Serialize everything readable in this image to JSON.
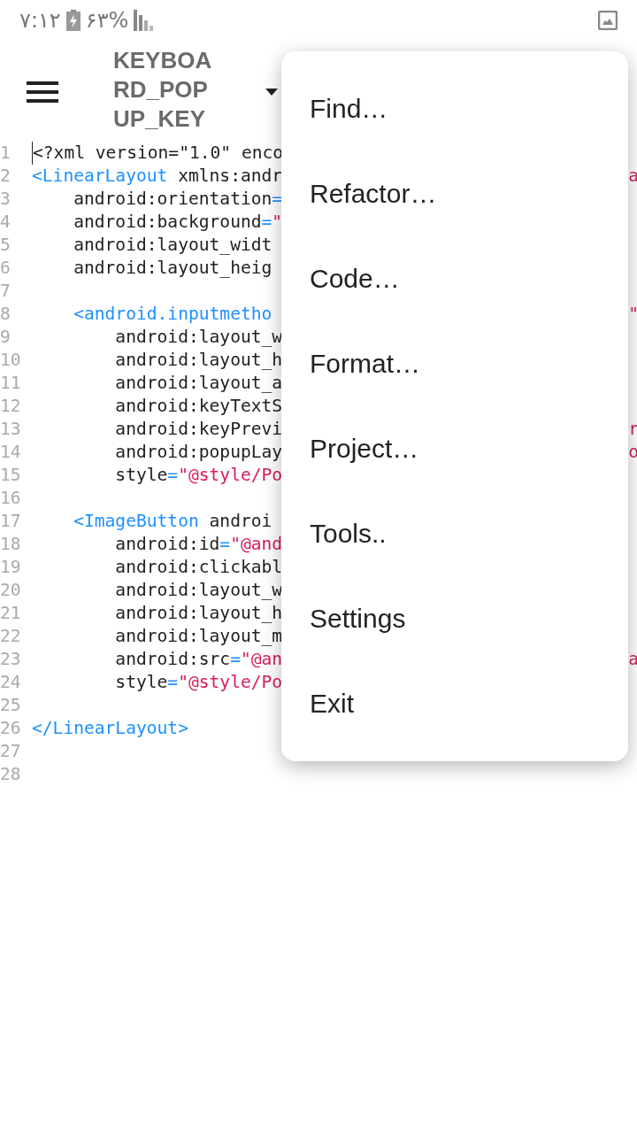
{
  "status_bar": {
    "time": "۷:۱۲",
    "battery": "۶۳%"
  },
  "toolbar": {
    "title": "KEYBOARD_POPUP_KEY"
  },
  "editor": {
    "lines": [
      {
        "number": "1",
        "cursor": true,
        "segments": [
          {
            "kind": "plain",
            "text": "<?xml version=\"1.0\" enco"
          }
        ]
      },
      {
        "number": "2",
        "cursor": false,
        "segments": [
          {
            "kind": "tag",
            "text": "<LinearLayout"
          },
          {
            "kind": "plain",
            "text": " xmlns:andr"
          }
        ],
        "tail": "a"
      },
      {
        "number": "3",
        "cursor": false,
        "segments": [
          {
            "kind": "plain",
            "text": "    android:orientation"
          },
          {
            "kind": "op",
            "text": "="
          }
        ]
      },
      {
        "number": "4",
        "cursor": false,
        "segments": [
          {
            "kind": "plain",
            "text": "    android:background"
          },
          {
            "kind": "op",
            "text": "="
          },
          {
            "kind": "value",
            "text": "\""
          }
        ]
      },
      {
        "number": "5",
        "cursor": false,
        "segments": [
          {
            "kind": "plain",
            "text": "    android:layout_widt"
          }
        ]
      },
      {
        "number": "6",
        "cursor": false,
        "segments": [
          {
            "kind": "plain",
            "text": "    android:layout_heig"
          }
        ]
      },
      {
        "number": "7",
        "cursor": false
      },
      {
        "number": "8",
        "cursor": false,
        "segments": [
          {
            "kind": "tag",
            "text": "    <android.inputmetho"
          }
        ],
        "tail": "\""
      },
      {
        "number": "9",
        "cursor": false,
        "segments": [
          {
            "kind": "plain",
            "text": "        android:layout_w"
          }
        ]
      },
      {
        "number": "10",
        "cursor": false,
        "segments": [
          {
            "kind": "plain",
            "text": "        android:layout_h"
          }
        ]
      },
      {
        "number": "11",
        "cursor": false,
        "segments": [
          {
            "kind": "plain",
            "text": "        android:layout_a"
          }
        ]
      },
      {
        "number": "12",
        "cursor": false,
        "segments": [
          {
            "kind": "plain",
            "text": "        android:keyTextS"
          }
        ]
      },
      {
        "number": "13",
        "cursor": false,
        "segments": [
          {
            "kind": "plain",
            "text": "        android:keyPrevi"
          }
        ],
        "tail": "r"
      },
      {
        "number": "14",
        "cursor": false,
        "segments": [
          {
            "kind": "plain",
            "text": "        android:popupLay"
          }
        ],
        "tail": "o"
      },
      {
        "number": "15",
        "cursor": false,
        "segments": [
          {
            "kind": "plain",
            "text": "        style"
          },
          {
            "kind": "op",
            "text": "="
          },
          {
            "kind": "value",
            "text": "\"@style/Po"
          }
        ]
      },
      {
        "number": "16",
        "cursor": false
      },
      {
        "number": "17",
        "cursor": false,
        "segments": [
          {
            "kind": "tag",
            "text": "    <ImageButton"
          },
          {
            "kind": "plain",
            "text": " androi"
          }
        ]
      },
      {
        "number": "18",
        "cursor": false,
        "segments": [
          {
            "kind": "plain",
            "text": "        android:id"
          },
          {
            "kind": "op",
            "text": "="
          },
          {
            "kind": "value",
            "text": "\"@and"
          }
        ]
      },
      {
        "number": "19",
        "cursor": false,
        "segments": [
          {
            "kind": "plain",
            "text": "        android:clickabl"
          }
        ]
      },
      {
        "number": "20",
        "cursor": false,
        "segments": [
          {
            "kind": "plain",
            "text": "        android:layout_w"
          }
        ]
      },
      {
        "number": "21",
        "cursor": false,
        "segments": [
          {
            "kind": "plain",
            "text": "        android:layout_h"
          }
        ]
      },
      {
        "number": "22",
        "cursor": false,
        "segments": [
          {
            "kind": "plain",
            "text": "        android:layout_m"
          }
        ]
      },
      {
        "number": "23",
        "cursor": false,
        "segments": [
          {
            "kind": "plain",
            "text": "        android:src"
          },
          {
            "kind": "op",
            "text": "="
          },
          {
            "kind": "value",
            "text": "\"@an"
          }
        ],
        "tail": "a"
      },
      {
        "number": "24",
        "cursor": false,
        "segments": [
          {
            "kind": "plain",
            "text": "        style"
          },
          {
            "kind": "op",
            "text": "="
          },
          {
            "kind": "value",
            "text": "\"@style/Po"
          }
        ]
      },
      {
        "number": "25",
        "cursor": false
      },
      {
        "number": "26",
        "cursor": false,
        "segments": [
          {
            "kind": "tag",
            "text": "</LinearLayout>"
          }
        ]
      },
      {
        "number": "27",
        "cursor": false
      },
      {
        "number": "28",
        "cursor": false
      }
    ]
  },
  "menu": {
    "items": [
      "Find…",
      "Refactor…",
      "Code…",
      "Format…",
      "Project…",
      "Tools..",
      "Settings",
      "Exit"
    ]
  }
}
